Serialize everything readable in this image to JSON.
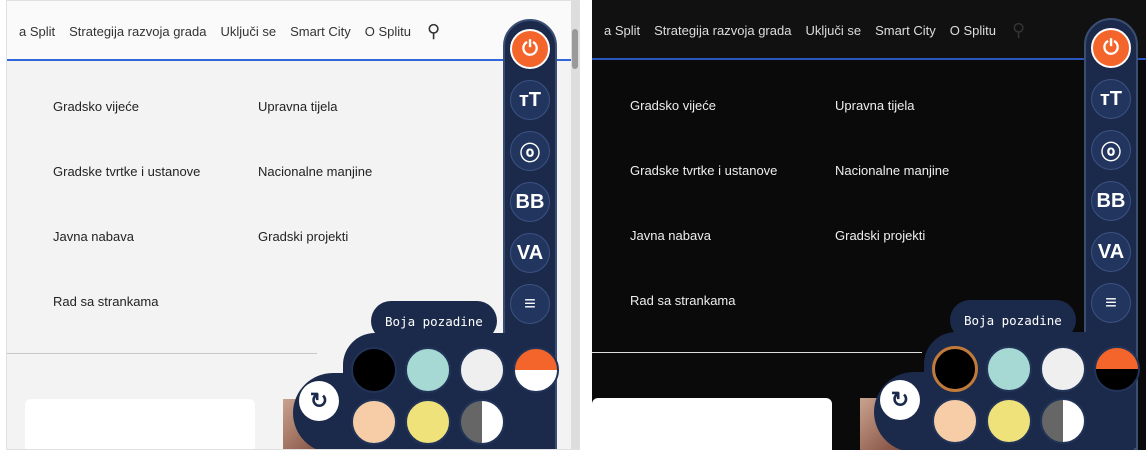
{
  "nav": {
    "items": [
      "a Split",
      "Strategija razvoja grada",
      "Uključi se",
      "Smart City",
      "O Splitu"
    ],
    "search_icon": "search-icon"
  },
  "menu": {
    "rows": [
      [
        "Gradsko vijeće",
        "Upravna tijela"
      ],
      [
        "Gradske tvrtke i ustanove",
        "Nacionalne manjine"
      ],
      [
        "Javna nabava",
        "Gradski projekti"
      ],
      [
        "Rad sa strankama",
        ""
      ]
    ]
  },
  "toolbar": {
    "buttons": [
      {
        "name": "power-icon",
        "glyph": "⏻"
      },
      {
        "name": "text-size-icon",
        "glyph": "тТ"
      },
      {
        "name": "cursor-icon",
        "glyph": "ⓞ"
      },
      {
        "name": "bold-icon",
        "glyph": "BB"
      },
      {
        "name": "letter-spacing-icon",
        "glyph": "VA"
      },
      {
        "name": "line-height-icon",
        "glyph": "≡"
      },
      {
        "name": "link-icon",
        "glyph": "🔗"
      }
    ]
  },
  "palette": {
    "label": "Boja pozadine",
    "reset_icon": "↻",
    "colors_row1": [
      "#000000",
      "#a6d9d3",
      "#efefef"
    ],
    "colors_row2": [
      "#f7cda8",
      "#f0e27a",
      "half-grey-white"
    ],
    "accent_top": "#f3652b",
    "accent_bottom_left": "#ffffff",
    "accent_bottom_right": "#000000"
  }
}
